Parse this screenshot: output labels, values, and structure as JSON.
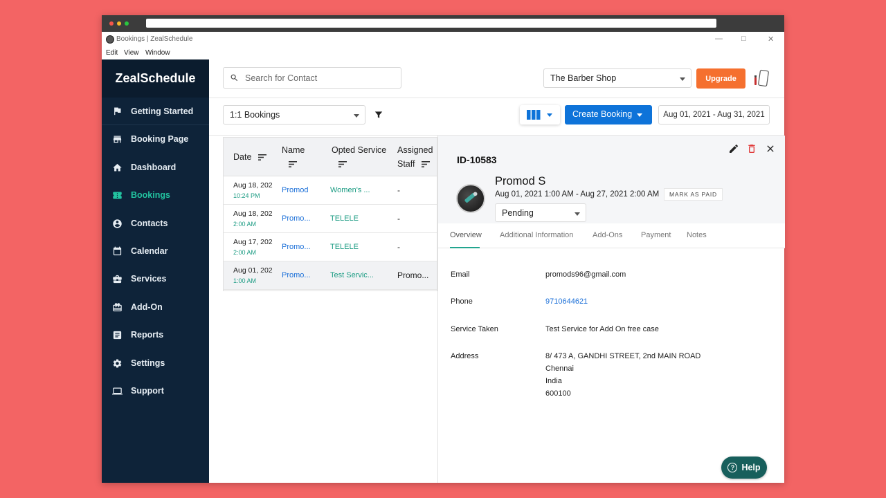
{
  "window": {
    "title": "Bookings | ZealSchedule"
  },
  "menu": [
    "Edit",
    "View",
    "Window"
  ],
  "sidebar": {
    "brand": "ZealSchedule",
    "items": [
      {
        "label": "Getting Started",
        "icon": "flag-icon"
      },
      {
        "label": "Booking Page",
        "icon": "storefront-icon"
      },
      {
        "label": "Dashboard",
        "icon": "home-icon"
      },
      {
        "label": "Bookings",
        "icon": "ticket-icon",
        "active": true
      },
      {
        "label": "Contacts",
        "icon": "account-circle-icon"
      },
      {
        "label": "Calendar",
        "icon": "calendar-icon"
      },
      {
        "label": "Services",
        "icon": "briefcase-icon"
      },
      {
        "label": "Add-On",
        "icon": "gift-card-icon"
      },
      {
        "label": "Reports",
        "icon": "report-icon"
      },
      {
        "label": "Settings",
        "icon": "gear-icon"
      },
      {
        "label": "Support",
        "icon": "laptop-icon"
      }
    ]
  },
  "header": {
    "search_placeholder": "Search for Contact",
    "shop": "The Barber Shop",
    "upgrade_label": "Upgrade"
  },
  "toolbar": {
    "view": "1:1 Bookings",
    "create_label": "Create Booking",
    "date_range": "Aug 01, 2021 - Aug 31, 2021"
  },
  "table": {
    "headers": {
      "date": "Date",
      "name": "Name",
      "service": "Opted Service",
      "staff_line1": "Assigned",
      "staff_line2": "Staff"
    },
    "rows": [
      {
        "date": "Aug 18, 202",
        "time": "10:24 PM",
        "name": "Promod",
        "service": "Women's ...",
        "staff": "-"
      },
      {
        "date": "Aug 18, 202",
        "time": "2:00 AM",
        "name": "Promo...",
        "service": "TELELE",
        "staff": "-"
      },
      {
        "date": "Aug 17, 202",
        "time": "2:00 AM",
        "name": "Promo...",
        "service": "TELELE",
        "staff": "-"
      },
      {
        "date": "Aug 01, 202",
        "time": "1:00 AM",
        "name": "Promo...",
        "service": "Test Servic...",
        "staff": "Promo..."
      }
    ]
  },
  "detail": {
    "id": "ID-10583",
    "customer": "Promod S",
    "time": "Aug 01, 2021 1:00 AM - Aug 27, 2021 2:00 AM",
    "mark_paid": "MARK AS PAID",
    "status": "Pending",
    "tabs": [
      "Overview",
      "Additional Information",
      "Add-Ons",
      "Payment",
      "Notes"
    ],
    "fields": {
      "email_label": "Email",
      "email": "promods96@gmail.com",
      "phone_label": "Phone",
      "phone": "9710644621",
      "service_label": "Service Taken",
      "service": "Test Service for Add On free case",
      "address_label": "Address",
      "address": [
        "8/ 473 A, GANDHI STREET, 2nd MAIN ROAD",
        "Chennai",
        "India",
        "600100"
      ]
    }
  },
  "help": {
    "label": "Help"
  },
  "colors": {
    "sidebar": "#0e2339",
    "accent_green": "#22c3a0",
    "primary_blue": "#0e73d9",
    "upgrade_orange": "#f5702f",
    "help_teal": "#175f5c",
    "background": "#f36464"
  }
}
